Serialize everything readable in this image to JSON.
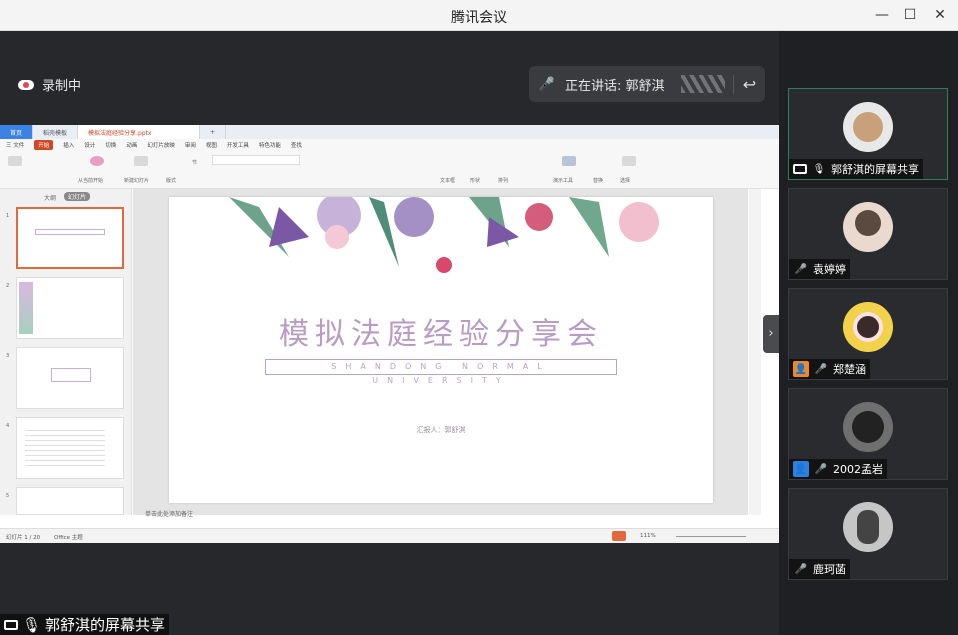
{
  "window": {
    "title": "腾讯会议"
  },
  "recording": {
    "label": "录制中"
  },
  "speaking": {
    "label": "正在讲话: 郭舒淇"
  },
  "share": {
    "tabs": [
      "首页",
      "稻壳模板",
      "模拟法庭经验分享.pptx"
    ],
    "menu": [
      "三 文件",
      "开始",
      "插入",
      "设计",
      "切换",
      "动画",
      "幻灯片放映",
      "审阅",
      "视图",
      "开发工具",
      "特色功能",
      "查找"
    ],
    "ribbon_items": [
      "从当前开始",
      "新建幻灯片",
      "版式",
      "节",
      "文本框",
      "形状",
      "排列",
      "演示工具",
      "替换",
      "选择"
    ],
    "thumbs_tabs": [
      "大纲",
      "幻灯片"
    ],
    "slide": {
      "title": "模拟法庭经验分享会",
      "subtitle": "SHANDONG NORMAL UNIVERSITY",
      "reporter": "汇报人：郭舒淇"
    },
    "note": "单击此处添加备注",
    "status": {
      "slide": "幻灯片 1 / 20",
      "theme": "Office 主题",
      "zoom": "111%"
    }
  },
  "share_label": "郭舒淇的屏幕共享",
  "participants": [
    {
      "name": "郭舒淇的屏幕共享",
      "avatar_color": "#e8e8e8",
      "mic": "on",
      "active": true
    },
    {
      "name": "袁婷婷",
      "avatar_color": "#e9d9cf",
      "mic": "off",
      "active": false
    },
    {
      "name": "郑楚涵",
      "avatar_color": "#f2d24a",
      "mic": "off",
      "active": false
    },
    {
      "name": "2002孟岩",
      "avatar_color": "#6f6f6f",
      "mic": "off",
      "active": false
    },
    {
      "name": "鹿珂菡",
      "avatar_color": "#c6c6c6",
      "mic": "off",
      "active": false
    }
  ]
}
